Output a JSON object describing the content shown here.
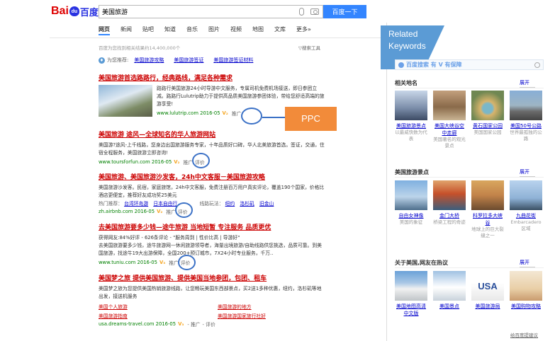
{
  "header": {
    "logo": {
      "bai": "Bai",
      "paw": "du",
      "du": "百度"
    },
    "search_value": "美国旅游",
    "search_button": "百度一下"
  },
  "nav": {
    "tabs": [
      "网页",
      "新闻",
      "贴吧",
      "知道",
      "音乐",
      "图片",
      "视频",
      "地图",
      "文库",
      "更多»"
    ]
  },
  "meta": {
    "result_count": "百度为您找到相关结果约14,400,000个",
    "tools": "▽搜索工具"
  },
  "recommend": {
    "label": "为您推荐:",
    "links": [
      "美国旅游攻略",
      "美国旅游签证",
      "美国旅游签证材料"
    ]
  },
  "results": [
    {
      "title": "美国旅游首选路路行，经典路线，满足各种需求",
      "desc": "路路行美国旅游24小时导游中文服务，专属司机免费机场接送，即日参团立减。路路行Lulutrip助力于提供高品质美国旅游参团体验，带给您舒适高端的旅游享受!",
      "url": "www.lulutrip.com",
      "date": "2016-05",
      "v": "V₂",
      "ad": "推广"
    },
    {
      "title": "美国旅游 途风—全球知名的华人旅游网站",
      "desc": "美国游?途风-上千线路，您身边出国旅游服务专家，十年品质好口碑，华人北美旅游首选。签证，交通，住宿全程服务，美国旅游立即咨询!",
      "url": "www.toursforfun.com",
      "date": "2016-05",
      "v": "V₂",
      "ad": "推广",
      "eval": "评价"
    },
    {
      "title": "美国旅游、美国旅游沙发客，24h中文客服－美国旅游攻略",
      "desc": "美国旅游沙发客。民宿，家庭旅馆，24h中文客服，免费注册百万用户真实评论，覆盖190个国家，价格比酒店更便宜，推荐好友成功奖25美元",
      "hot_label": "热门推荐：",
      "hot_links": [
        "台湾环岛游",
        "日本自由行"
      ],
      "line_label": "线路玩法：",
      "line_links": [
        "纽约",
        "洛杉矶",
        "旧金山"
      ],
      "url": "zh.airbnb.com",
      "date": "2016-05",
      "v": "V₂",
      "ad": "推广",
      "eval": "评价"
    },
    {
      "title": "去美国旅游要多少钱—途牛旅游 当地短暂 专注服务 品质更优",
      "desc": "获得网友:84%好评 - 626条评论 - \"服务周到 | 性价比高 | 导游好\"\n去美国旅游要多少钱，途牛旅游网—休闲旅游领导者，海量出境旅游/自助线路供您挑选，品质可靠。到美国旅游，找途牛19大出游保障，全国200+预订城市，7X24小时专业服务，千万..",
      "url": "www.tuniu.com",
      "date": "2016-05",
      "v": "V₃",
      "ad": "推广",
      "eval": "评价"
    },
    {
      "title": "美国梦之旅 提供美国旅游、提供美国当地参团，包团、租车",
      "desc": "美国梦之旅为您提供美国热销旅游线路，让您畅玩美国东西部景点，买2送1多种优惠，纽约，洛杉矶等地出发，接送机服务",
      "sub_links": [
        "美国个人旅游",
        "美国旅游的地方",
        "美国旅游指南",
        "美国旅游国家旅行社好"
      ],
      "url": "usa.dreams-travel.com",
      "date": "2016-05",
      "v": "V₃",
      "ad": "- 推广",
      "eval": "- 评价"
    }
  ],
  "annotations": {
    "ppc": "PPC",
    "related": [
      "Related",
      "Keywords"
    ]
  },
  "right_panel": {
    "banner": "百度搜索  有 V 有保障",
    "more_label": "展开",
    "sections": [
      {
        "title": "相关地名",
        "items": [
          {
            "name": "美国旅游景点",
            "sub": "以最威快数为代表"
          },
          {
            "name": "美国大峡谷空中走廊",
            "sub": "美国著名的观光景点"
          },
          {
            "name": "黄石国家公园",
            "sub": "美国国家公园"
          },
          {
            "name": "美国50号公路",
            "sub": "世界最孤独的公路"
          }
        ]
      },
      {
        "title": "美国旅游景点",
        "items": [
          {
            "name": "自由女神像",
            "sub": "美国的象征"
          },
          {
            "name": "金门大桥",
            "sub": "桥梁工程的奇迹"
          },
          {
            "name": "科罗拉多大峡谷",
            "sub": "地球上的巨大裂缝之一"
          },
          {
            "name": "九曲花街",
            "sub": "Embarcadero区域"
          }
        ]
      },
      {
        "title": "关于美国,网友在热议",
        "items": [
          {
            "name": "美国地图高清中文版",
            "sub": ""
          },
          {
            "name": "美国景点",
            "sub": ""
          },
          {
            "name": "美国旅游局",
            "sub": ""
          },
          {
            "name": "美国购物攻略",
            "sub": ""
          }
        ]
      }
    ],
    "feedback": "给百度提建议"
  }
}
